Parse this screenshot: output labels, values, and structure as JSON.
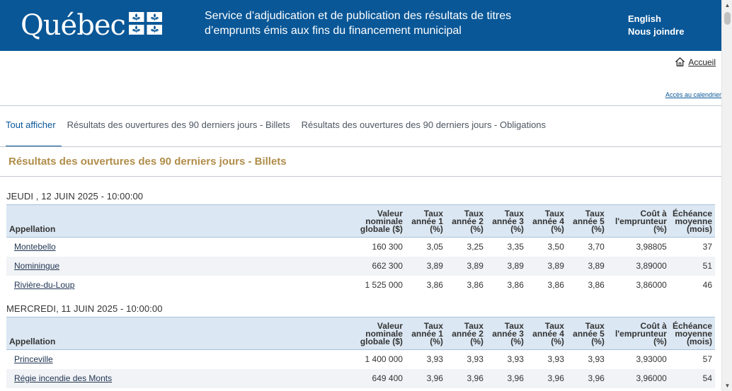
{
  "header": {
    "logo_text": "Québec",
    "site_title": "Service d’adjudication et de publication des résultats de titres d’emprunts émis aux fins du financement municipal",
    "links": [
      "English",
      "Nous joindre"
    ],
    "brand_color": "#095797"
  },
  "nav": {
    "home_label": "Accueil",
    "home_icon": "home-icon",
    "calendar_link": "Accès au calendrier"
  },
  "tabs": [
    {
      "label": "Tout afficher",
      "active": true
    },
    {
      "label": "Résultats des ouvertures des 90 derniers jours - Billets",
      "active": false
    },
    {
      "label": "Résultats des ouvertures des 90 derniers jours - Obligations",
      "active": false
    }
  ],
  "section_title": "Résultats des ouvertures des 90 derniers jours - Billets",
  "table_headers": {
    "appellation": "Appellation",
    "valeur": [
      "Valeur",
      "nominale",
      "globale ($)"
    ],
    "taux1": [
      "Taux",
      "année 1",
      "(%)"
    ],
    "taux2": [
      "Taux",
      "année 2",
      "(%)"
    ],
    "taux3": [
      "Taux",
      "année 3",
      "(%)"
    ],
    "taux4": [
      "Taux",
      "année 4",
      "(%)"
    ],
    "taux5": [
      "Taux",
      "année 5",
      "(%)"
    ],
    "cout": [
      "Coût à",
      "l'emprunteur",
      "(%)"
    ],
    "echeance": [
      "Échéance",
      "moyenne",
      "(mois)"
    ]
  },
  "groups": [
    {
      "date": "JEUDI , 12 JUIN 2025 - 10:00:00",
      "rows": [
        {
          "appellation": "Montebello",
          "valeur": "160 300",
          "t1": "3,05",
          "t2": "3,25",
          "t3": "3,35",
          "t4": "3,50",
          "t5": "3,70",
          "cout": "3,98805",
          "echeance": "37"
        },
        {
          "appellation": "Nominingue",
          "valeur": "662 300",
          "t1": "3,89",
          "t2": "3,89",
          "t3": "3,89",
          "t4": "3,89",
          "t5": "3,89",
          "cout": "3,89000",
          "echeance": "51"
        },
        {
          "appellation": "Rivière-du-Loup",
          "valeur": "1 525 000",
          "t1": "3,86",
          "t2": "3,86",
          "t3": "3,86",
          "t4": "3,86",
          "t5": "3,86",
          "cout": "3,86000",
          "echeance": "46"
        }
      ]
    },
    {
      "date": "MERCREDI, 11 JUIN 2025 - 10:00:00",
      "rows": [
        {
          "appellation": "Princeville",
          "valeur": "1 400 000",
          "t1": "3,93",
          "t2": "3,93",
          "t3": "3,93",
          "t4": "3,93",
          "t5": "3,93",
          "cout": "3,93000",
          "echeance": "57"
        },
        {
          "appellation": "Régie incendie des Monts",
          "valeur": "649 400",
          "t1": "3,96",
          "t2": "3,96",
          "t3": "3,96",
          "t4": "3,96",
          "t5": "3,96",
          "cout": "3,96000",
          "echeance": "54"
        }
      ]
    }
  ],
  "colors": {
    "accent": "#095797",
    "section_title": "#b08d4a",
    "table_header_bg": "#dbe7f2",
    "stripe": "#f1f3f6"
  }
}
